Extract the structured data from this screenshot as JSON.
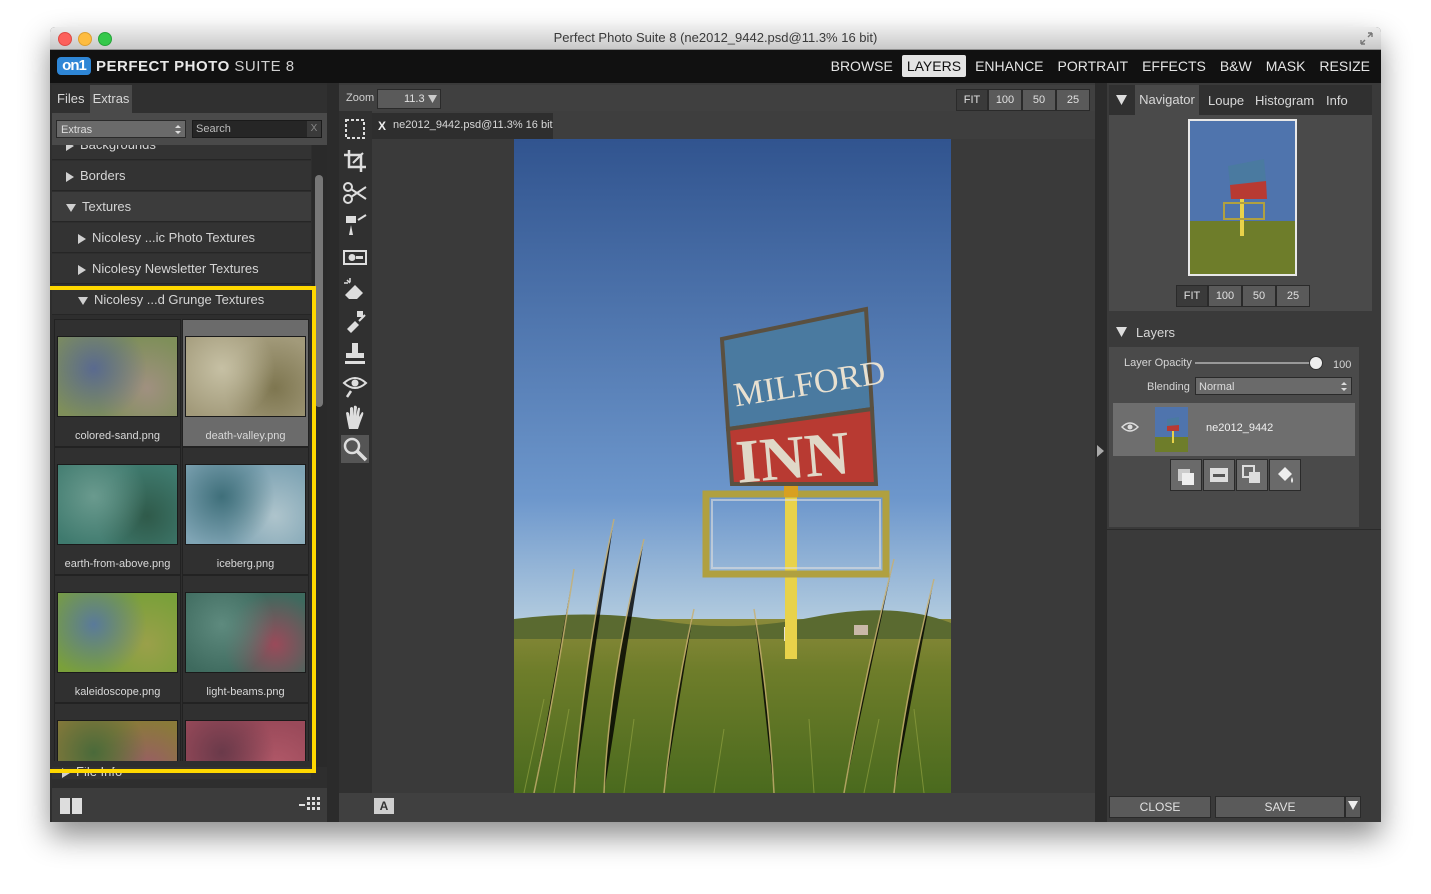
{
  "window": {
    "title": "Perfect Photo Suite 8 (ne2012_9442.psd@11.3% 16 bit)"
  },
  "app": {
    "logo_mark": "on1",
    "logo_bold": "PERFECT PHOTO",
    "logo_thin": "SUITE 8"
  },
  "topnav": [
    "BROWSE",
    "LAYERS",
    "ENHANCE",
    "PORTRAIT",
    "EFFECTS",
    "B&W",
    "MASK",
    "RESIZE"
  ],
  "topnav_active": "LAYERS",
  "left_panel": {
    "tabs": [
      "Files",
      "Extras"
    ],
    "dropdown_value": "Extras",
    "search_placeholder": "Search",
    "search_clear": "X",
    "tree": [
      {
        "label": "Backgrounds",
        "expanded": false,
        "level": 0
      },
      {
        "label": "Borders",
        "expanded": false,
        "level": 0
      },
      {
        "label": "Textures",
        "expanded": true,
        "level": 0
      },
      {
        "label": "Nicolesy ...ic Photo Textures",
        "expanded": false,
        "level": 1
      },
      {
        "label": "Nicolesy Newsletter Textures",
        "expanded": false,
        "level": 1
      },
      {
        "label": "Nicolesy ...d Grunge Textures",
        "expanded": true,
        "level": 1
      }
    ],
    "thumbnails": [
      {
        "label": "colored-sand.png",
        "c1": "#7f8f5a",
        "c2": "#5a6a8f",
        "c3": "#a09080"
      },
      {
        "label": "death-valley.png",
        "c1": "#a29a7a",
        "c2": "#c6c0a4",
        "c3": "#7e7650"
      },
      {
        "label": "earth-from-above.png",
        "c1": "#3f7a6e",
        "c2": "#6a9a8e",
        "c3": "#2f5a4a"
      },
      {
        "label": "iceberg.png",
        "c1": "#7fa4b4",
        "c2": "#3f6f7a",
        "c3": "#aec4cc"
      },
      {
        "label": "kaleidoscope.png",
        "c1": "#7aa03a",
        "c2": "#5a7a9a",
        "c3": "#9aa04a"
      },
      {
        "label": "light-beams.png",
        "c1": "#3e6a5e",
        "c2": "#5e8a7e",
        "c3": "#9a4a5a"
      },
      {
        "label": "",
        "c1": "#8a7a3a",
        "c2": "#4a6a3a",
        "c3": "#9a5a6a"
      },
      {
        "label": "",
        "c1": "#9a4a5a",
        "c2": "#6a3a4a",
        "c3": "#b45a6a"
      }
    ],
    "file_info": "File Info",
    "highlight_color": "#ffd800"
  },
  "center": {
    "zoom_label": "Zoom",
    "zoom_value": "11.3",
    "zoom_buttons": [
      "FIT",
      "100",
      "50",
      "25"
    ],
    "doc_tab_close": "X",
    "doc_tab": "ne2012_9442.psd@11.3% 16 bit",
    "bottom_button": "A",
    "photo": {
      "sign_top": "MILFORD",
      "sign_bottom": "INN"
    }
  },
  "right_panel": {
    "tabs": [
      "Navigator",
      "Loupe",
      "Histogram",
      "Info"
    ],
    "nav_buttons": [
      "FIT",
      "100",
      "50",
      "25"
    ],
    "layers_title": "Layers",
    "layer_opacity_label": "Layer Opacity",
    "layer_opacity_value": "100",
    "layer_opacity_fraction": 1.0,
    "blending_label": "Blending",
    "blending_value": "Normal",
    "layer_name": "ne2012_9442",
    "close_button": "CLOSE",
    "save_button": "SAVE"
  }
}
